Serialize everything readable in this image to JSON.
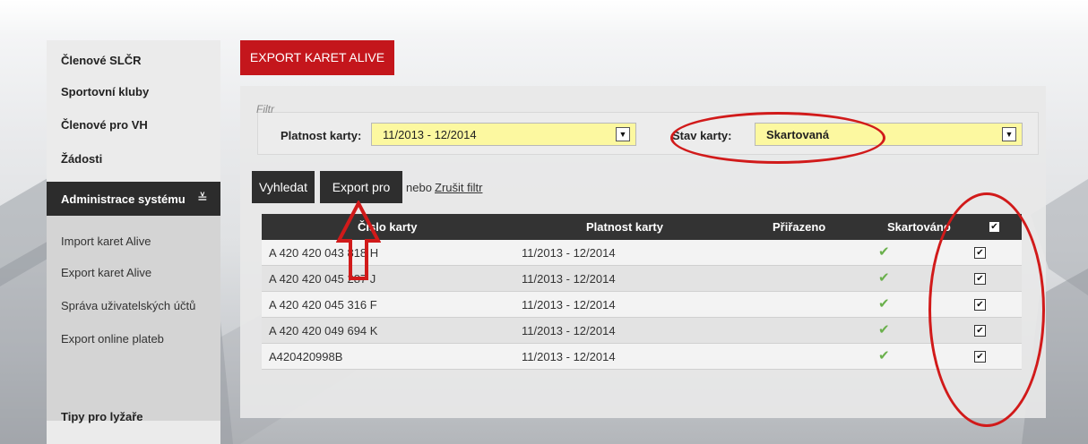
{
  "sidebar": {
    "items": [
      {
        "label": "Členové SLČR"
      },
      {
        "label": "Sportovní kluby"
      },
      {
        "label": "Členové pro VH"
      },
      {
        "label": "Žádosti"
      }
    ],
    "admin_label": "Administrace systému",
    "admin_icon": "double-chevron-down-icon",
    "sub_items": [
      {
        "label": "Import karet Alive"
      },
      {
        "label": "Export karet Alive"
      },
      {
        "label": "Správa uživatelských účtů"
      },
      {
        "label": "Export online plateb"
      }
    ],
    "bottom_label": "Tipy pro lyžaře"
  },
  "page_title": "EXPORT KARET ALIVE",
  "filter": {
    "legend": "Filtr",
    "validity_label": "Platnost karty:",
    "validity_value": "11/2013 - 12/2014",
    "state_label": "Stav karty:",
    "state_value": "Skartovaná"
  },
  "buttons": {
    "search": "Vyhledat",
    "export": "Export pro Alive",
    "or_text": "nebo",
    "cancel_link": "Zrušit filtr"
  },
  "table": {
    "headers": {
      "card": "Číslo karty",
      "validity": "Platnost karty",
      "assigned": "Přiřazeno",
      "shredded": "Skartováno"
    },
    "rows": [
      {
        "card": "A 420 420 043 818 H",
        "validity": "11/2013 - 12/2014",
        "assigned": "",
        "shredded": "✔",
        "selected": "✔"
      },
      {
        "card": "A 420 420 045 287 J",
        "validity": "11/2013 - 12/2014",
        "assigned": "",
        "shredded": "✔",
        "selected": "✔"
      },
      {
        "card": "A 420 420 045 316 F",
        "validity": "11/2013 - 12/2014",
        "assigned": "",
        "shredded": "✔",
        "selected": "✔"
      },
      {
        "card": "A 420 420 049 694 K",
        "validity": "11/2013 - 12/2014",
        "assigned": "",
        "shredded": "✔",
        "selected": "✔"
      },
      {
        "card": "A420420998B",
        "validity": "11/2013 - 12/2014",
        "assigned": "",
        "shredded": "✔",
        "selected": "✔"
      }
    ],
    "header_checkbox": "✔"
  },
  "colors": {
    "accent": "#c4161c",
    "annotation": "#d11a1a",
    "select_bg": "#fcf8a0",
    "dark": "#2e2e2e",
    "check_green": "#6ab04c"
  }
}
